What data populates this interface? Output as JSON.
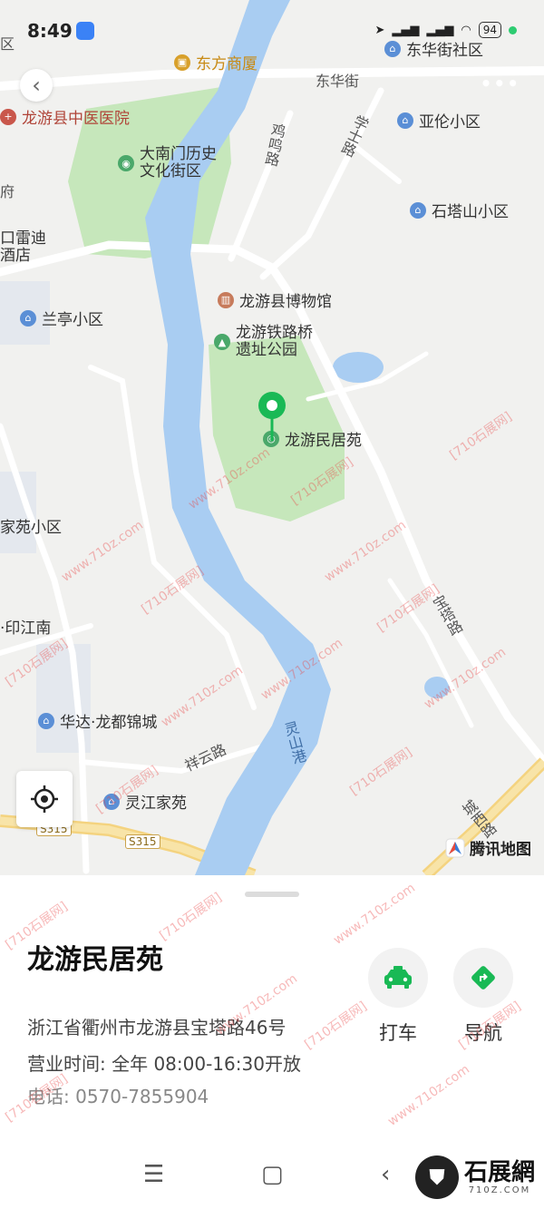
{
  "status_bar": {
    "time": "8:49",
    "battery": "94",
    "signal_icons": [
      "location-arrow-icon",
      "hd-signal-icon",
      "hd-signal-icon",
      "wifi-icon"
    ]
  },
  "map": {
    "pois": [
      {
        "id": "dongfang",
        "label": "东方商厦",
        "icon": "shop-icon",
        "color": "#d8a02a"
      },
      {
        "id": "donghuajie-sq",
        "label": "东华街社区",
        "icon": "residential-icon",
        "color": "#5b8fd6"
      },
      {
        "id": "hospital",
        "label": "龙游县中医医院",
        "icon": "hospital-icon",
        "color": "#c9574b"
      },
      {
        "id": "yalun",
        "label": "亚伦小区",
        "icon": "residential-icon",
        "color": "#5b8fd6"
      },
      {
        "id": "danmen",
        "label_line1": "大南门历史",
        "label_line2": "文化街区",
        "icon": "camera-icon",
        "color": "#4aa86a"
      },
      {
        "id": "shitashan",
        "label": "石塔山小区",
        "icon": "residential-icon",
        "color": "#5b8fd6"
      },
      {
        "id": "leidi",
        "label_line1": "口雷迪",
        "label_line2": "酒店"
      },
      {
        "id": "museum",
        "label": "龙游县博物馆",
        "icon": "museum-icon",
        "color": "#c77b5b"
      },
      {
        "id": "lanting",
        "label": "兰亭小区",
        "icon": "residential-icon",
        "color": "#5b8fd6"
      },
      {
        "id": "railbridge",
        "label_line1": "龙游铁路桥",
        "label_line2": "遗址公园",
        "icon": "tree-icon",
        "color": "#4aa86a"
      },
      {
        "id": "minjuyuan",
        "label": "龙游民居苑",
        "icon": "scenic-icon",
        "color": "#4aa86a"
      },
      {
        "id": "jiajiayuan",
        "label": "家苑小区"
      },
      {
        "id": "yinjiangnan",
        "label": "·印江南"
      },
      {
        "id": "huada",
        "label": "华达·龙都锦城",
        "icon": "residential-icon",
        "color": "#5b8fd6"
      },
      {
        "id": "lingjiang",
        "label": "灵江家苑",
        "icon": "residential-icon",
        "color": "#5b8fd6"
      }
    ],
    "roads": {
      "donghua": "东华街",
      "jiming": "鸡鸣路",
      "xueshi": "学士路",
      "baota": "宝塔路",
      "xiangyun": "祥云路",
      "chengxi": "城西路",
      "s315a": "S315",
      "s315b": "S315",
      "river": "灵山港"
    },
    "attribution": "腾讯地图",
    "fragment_left_top": "区",
    "fragment_left_2": "府"
  },
  "place": {
    "name": "龙游民居苑",
    "address": "浙江省衢州市龙游县宝塔路46号",
    "hours": "营业时间: 全年 08:00-16:30开放",
    "phone": "电话: 0570-7855904"
  },
  "actions": {
    "taxi": {
      "label": "打车",
      "icon": "taxi-icon",
      "color": "#19b955"
    },
    "navigate": {
      "label": "导航",
      "icon": "navigation-icon",
      "color": "#19b955"
    }
  },
  "watermark": {
    "brand": "石展網",
    "brand_sub": "710Z.COM",
    "text_a": "[710石展网]",
    "text_b": "www.710z.com"
  },
  "colors": {
    "accent": "#19b955",
    "river": "#a9cdf2",
    "park": "#bfe6b3"
  }
}
